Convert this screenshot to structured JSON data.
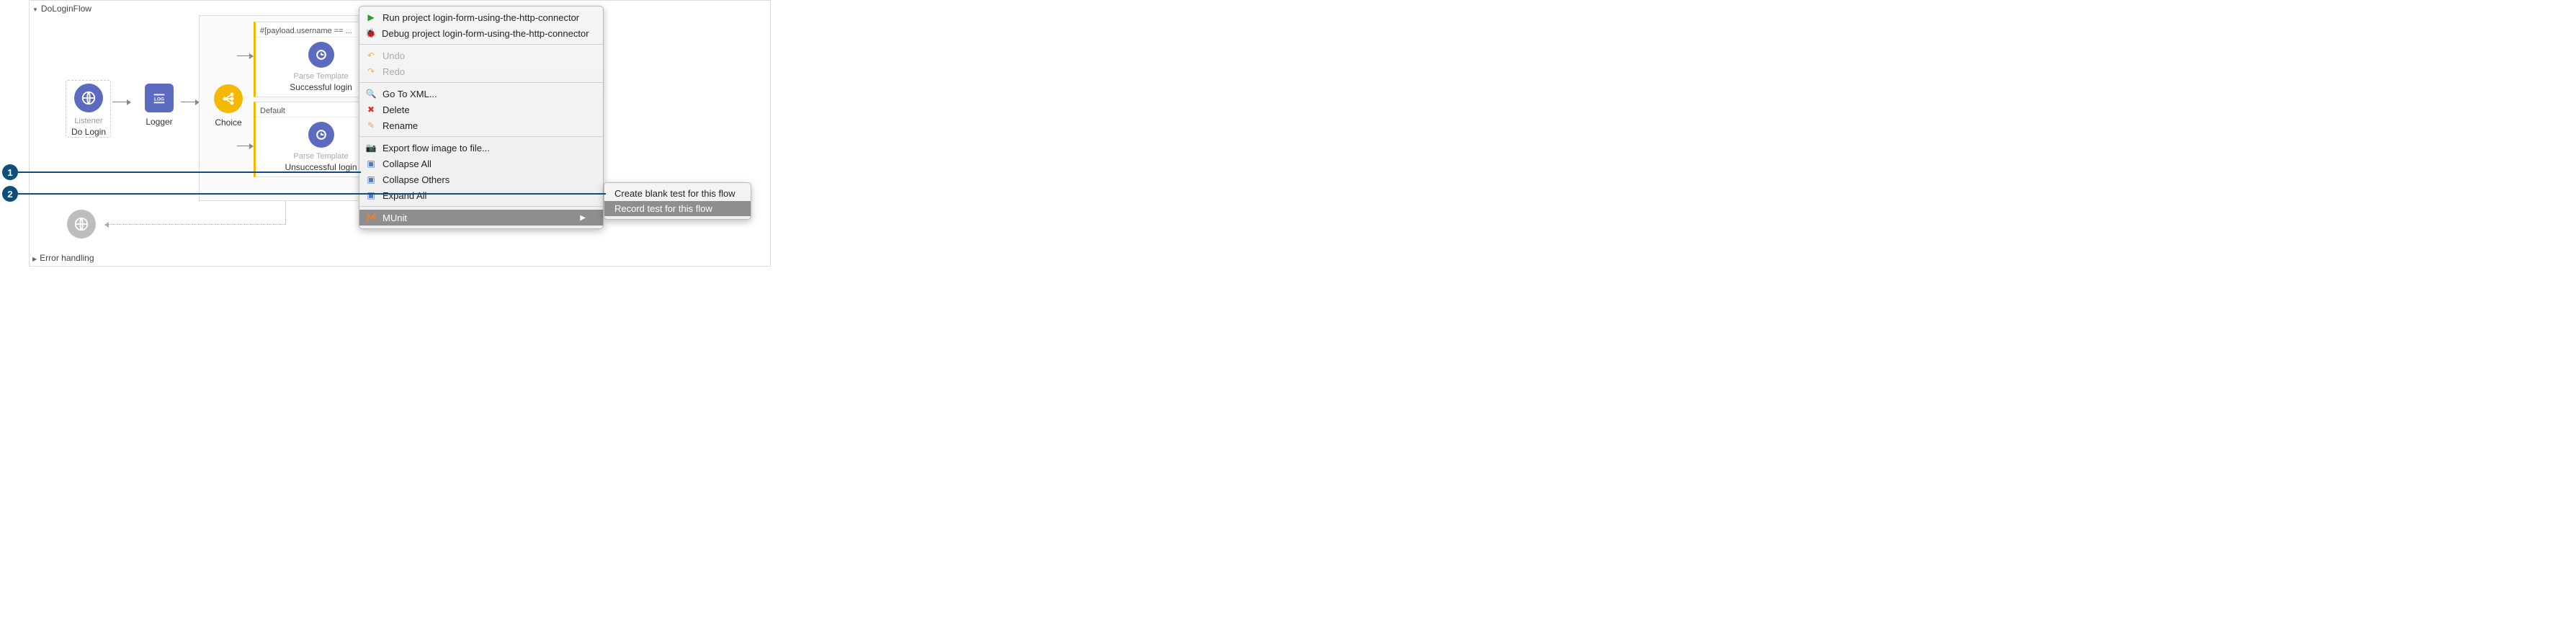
{
  "flow": {
    "title": "DoLoginFlow",
    "error_section": "Error handling",
    "nodes": {
      "listener": {
        "type": "Listener",
        "label": "Do Login"
      },
      "logger": {
        "type": "Logger",
        "label": ""
      },
      "choice": {
        "type": "Choice",
        "label": ""
      },
      "branch1": {
        "condition": "#[payload.username == ...",
        "node_type": "Parse Template",
        "node_label": "Successful login"
      },
      "branch2": {
        "condition": "Default",
        "node_type": "Parse Template",
        "node_label": "Unsuccessful login"
      }
    }
  },
  "menu": {
    "run": "Run project login-form-using-the-http-connector",
    "debug": "Debug project login-form-using-the-http-connector",
    "undo": "Undo",
    "redo": "Redo",
    "goto_xml": "Go To XML...",
    "delete": "Delete",
    "rename": "Rename",
    "export_image": "Export flow image to file...",
    "collapse_all": "Collapse All",
    "collapse_others": "Collapse Others",
    "expand_all": "Expand All",
    "munit": "MUnit"
  },
  "submenu": {
    "create_blank": "Create blank test for this flow",
    "record_test": "Record test for this flow"
  },
  "callouts": {
    "c1": "1",
    "c2": "2"
  }
}
